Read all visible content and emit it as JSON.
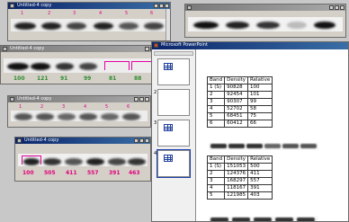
{
  "windows": {
    "top_left": {
      "title": "Untitled-4 copy",
      "lane_numbers": [
        "1",
        "2",
        "3",
        "4",
        "5",
        "6"
      ]
    },
    "top_right": {
      "title": ""
    },
    "mid_left": {
      "title": "Untitled-4 copy",
      "values": [
        "100",
        "121",
        "91",
        "99",
        "81",
        "88"
      ]
    },
    "lower_left": {
      "title": "Untitled-4 copy",
      "lane_numbers": [
        "1",
        "2",
        "3",
        "4",
        "5",
        "6"
      ]
    },
    "bottom_left": {
      "title": "Untitled-4 copy",
      "values": [
        "100",
        "505",
        "411",
        "557",
        "391",
        "463"
      ]
    }
  },
  "powerpoint": {
    "title": "Microsoft PowerPoint",
    "slides": [
      {
        "num": "1"
      },
      {
        "num": "2"
      },
      {
        "num": "3"
      },
      {
        "num": "4"
      }
    ],
    "table1": {
      "headers": [
        "Band",
        "Density",
        "Relative"
      ],
      "rows": [
        [
          "1 (S)",
          "90828",
          "100"
        ],
        [
          "2",
          "92454",
          "101"
        ],
        [
          "3",
          "90307",
          "99"
        ],
        [
          "4",
          "52702",
          "58"
        ],
        [
          "5",
          "68451",
          "75"
        ],
        [
          "6",
          "60412",
          "66"
        ]
      ]
    },
    "table2": {
      "headers": [
        "Band",
        "Density",
        "Relative"
      ],
      "rows": [
        [
          "1 (S)",
          "151053",
          "500"
        ],
        [
          "2",
          "124376",
          "411"
        ],
        [
          "3",
          "168297",
          "557"
        ],
        [
          "4",
          "118167",
          "391"
        ],
        [
          "5",
          "121985",
          "403"
        ]
      ]
    }
  },
  "colors": {
    "titlebar_active": "#0a246a",
    "value_green": "#2e8b2e",
    "bracket_magenta": "#e600a0"
  }
}
